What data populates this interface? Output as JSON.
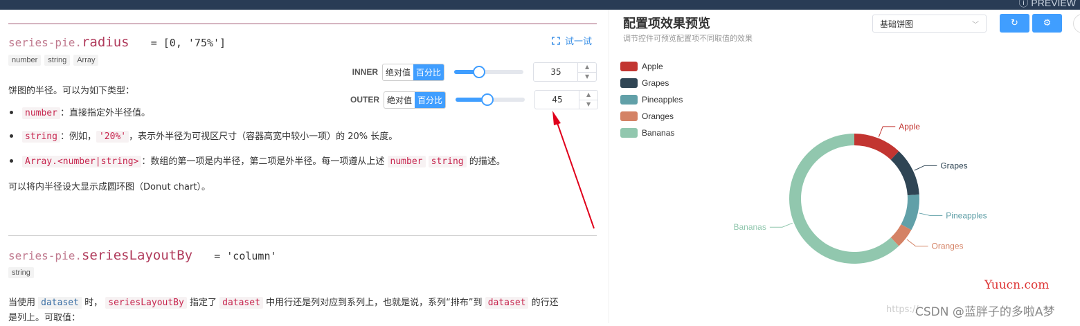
{
  "topbar": {
    "text": "ⓘ PREVIEW"
  },
  "doc": {
    "radius": {
      "prefix": "series-pie.",
      "name": "radius",
      "default": "= [0, '75%']",
      "types": [
        "number",
        "string",
        "Array"
      ],
      "try_label": "试一试",
      "inner": {
        "label": "INNER",
        "abs": "绝对值",
        "pct": "百分比",
        "value": "35",
        "slider_level": 0.35
      },
      "outer": {
        "label": "OUTER",
        "abs": "绝对值",
        "pct": "百分比",
        "value": "45",
        "slider_level": 0.45
      },
      "desc_intro": "饼图的半径。可以为如下类型：",
      "b1_code": "number",
      "b1_text": "：直接指定外半径值。",
      "b2_code": "string",
      "b2_text1": "：例如，",
      "b2_code2": "'20%'",
      "b2_text2": "，表示外半径为可视区尺寸（容器高宽中较小一项）的 20% 长度。",
      "b3_code": "Array.<number|string>",
      "b3_text": "：数组的第一项是内半径，第二项是外半径。每一项遵从上述",
      "b3_code2": "number",
      "b3_code3": "string",
      "b3_text2": "的描述。",
      "desc_outro": "可以将内半径设大显示成圆环图（Donut chart）。"
    },
    "layout": {
      "prefix": "series-pie.",
      "name": "seriesLayoutBy",
      "default": "= 'column'",
      "types": [
        "string"
      ],
      "p1": "当使用",
      "c1": "dataset",
      "p2": "时，",
      "c2": "seriesLayoutBy",
      "p3": "指定了",
      "c3": "dataset",
      "p4": "中用行还是列对应到系列上，也就是说，系列“排布”到",
      "c4": "dataset",
      "p5": "的行还",
      "line2": "是列上。可取值："
    }
  },
  "preview": {
    "title": "配置项效果预览",
    "subtitle": "调节控件可预览配置项不同取值的效果",
    "select_value": "基础饼图",
    "refresh_icon": "↻",
    "settings_icon": "⚙",
    "close_icon": "»"
  },
  "chart_data": {
    "type": "pie",
    "categories": [
      "Apple",
      "Grapes",
      "Pineapples",
      "Oranges",
      "Bananas"
    ],
    "values": [
      12,
      12,
      9,
      5,
      62
    ],
    "colors": [
      "#c23531",
      "#2f4554",
      "#61a0a8",
      "#d48265",
      "#91c7ae"
    ],
    "radius": [
      "35%",
      "45%"
    ],
    "legend_position": "top-left"
  },
  "watermarks": {
    "url": "https://",
    "csdn": "CSDN @蓝胖子的多啦A梦",
    "yuucn": "Yuucn.com"
  }
}
